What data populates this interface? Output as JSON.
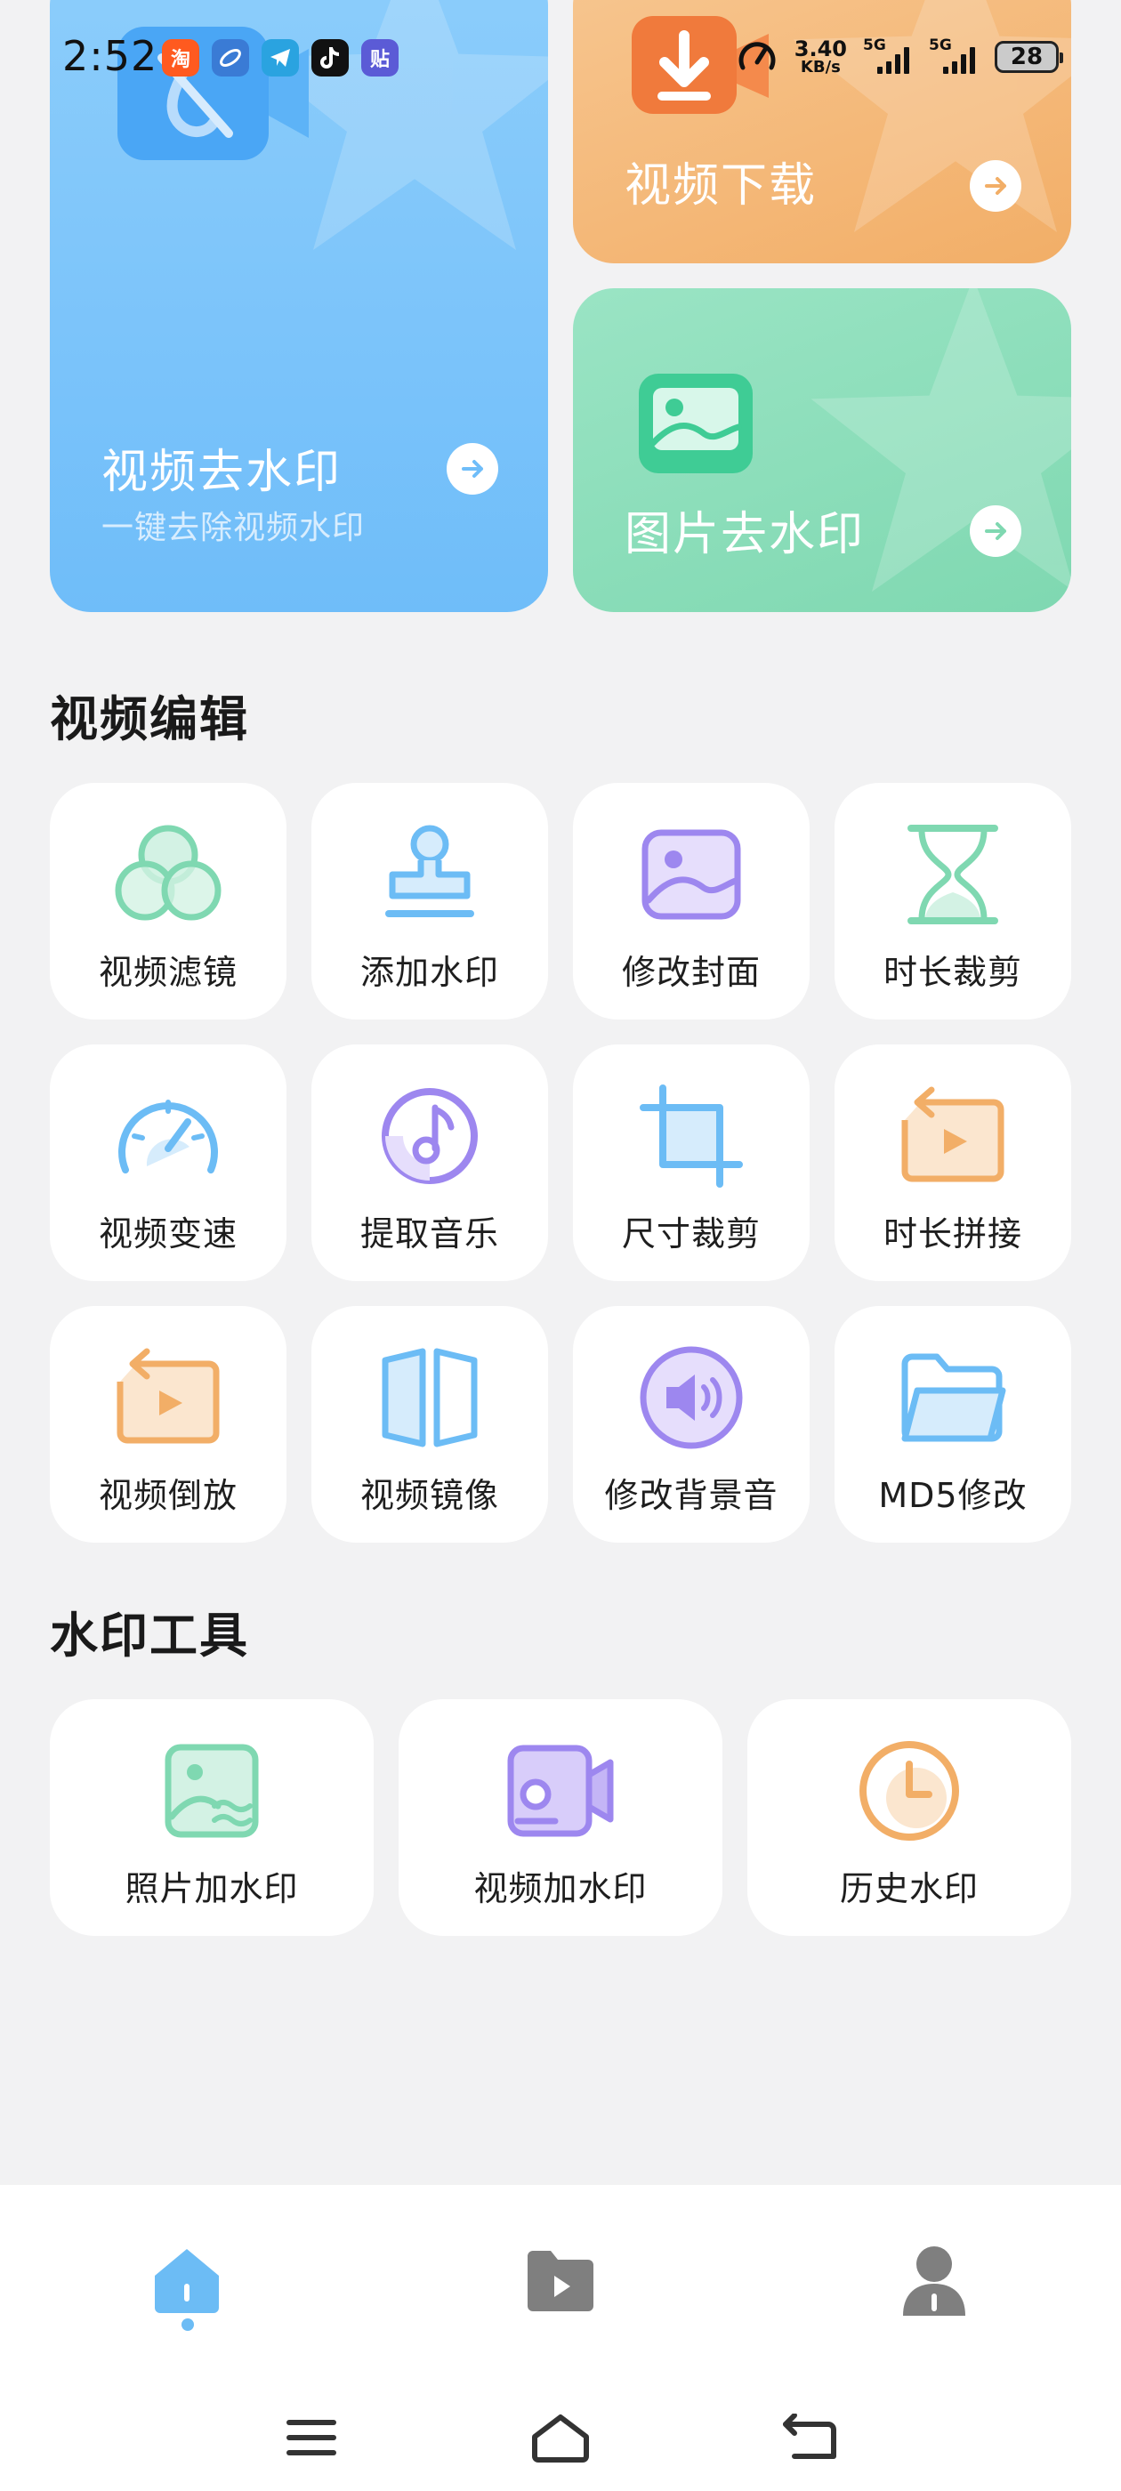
{
  "status_bar": {
    "time": "2:52",
    "apps": [
      {
        "name": "taobao-app-icon",
        "glyph": "淘",
        "color": "#ff5a1f"
      },
      {
        "name": "browser-app-icon",
        "glyph": "",
        "color": "#3a7bd5"
      },
      {
        "name": "telegram-app-icon",
        "glyph": "",
        "color": "#2aa3e0"
      },
      {
        "name": "tiktok-app-icon",
        "glyph": "",
        "color": "#111111"
      },
      {
        "name": "tieba-app-icon",
        "glyph": "贴",
        "color": "#5b5bd6"
      }
    ],
    "net_speed_value": "3.40",
    "net_speed_unit": "KB/s",
    "signal_1_label": "5G",
    "signal_2_label": "5G",
    "battery": "28"
  },
  "hero": {
    "remove_video_watermark": {
      "title": "视频去水印",
      "subtitle": "一键去除视频水印"
    },
    "video_download": {
      "title": "视频下载"
    },
    "remove_image_watermark": {
      "title": "图片去水印"
    }
  },
  "video_edit": {
    "title": "视频编辑",
    "items": [
      {
        "label": "视频滤镜"
      },
      {
        "label": "添加水印"
      },
      {
        "label": "修改封面"
      },
      {
        "label": "时长裁剪"
      },
      {
        "label": "视频变速"
      },
      {
        "label": "提取音乐"
      },
      {
        "label": "尺寸裁剪"
      },
      {
        "label": "时长拼接"
      },
      {
        "label": "视频倒放"
      },
      {
        "label": "视频镜像"
      },
      {
        "label": "修改背景音"
      },
      {
        "label": "MD5修改"
      }
    ]
  },
  "watermark_tools": {
    "title": "水印工具",
    "items": [
      {
        "label": "照片加水印"
      },
      {
        "label": "视频加水印"
      },
      {
        "label": "历史水印"
      }
    ]
  },
  "colors": {
    "accent_blue": "#6cbcf5",
    "accent_green": "#7fd8b1",
    "accent_orange": "#f2ae67",
    "accent_purple": "#9d87ef",
    "nav_inactive": "#7f7f7f"
  }
}
